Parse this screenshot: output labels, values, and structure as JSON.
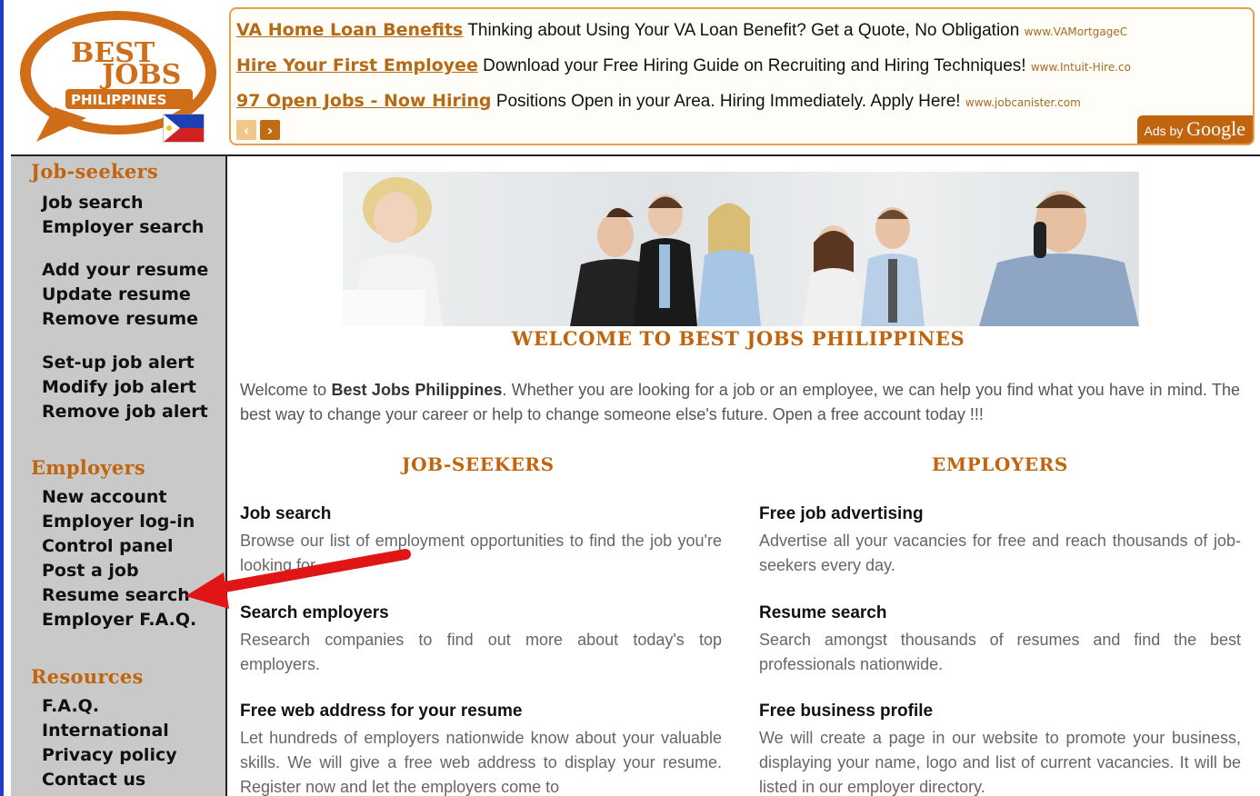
{
  "logo": {
    "line1": "BEST",
    "line2": "JOBS",
    "line3": "PHILIPPINES"
  },
  "ads": {
    "items": [
      {
        "title": "VA Home Loan Benefits",
        "text": "Thinking about Using Your VA Loan Benefit? Get a Quote, No Obligation",
        "url": "www.VAMortgageC"
      },
      {
        "title": "Hire Your First Employee",
        "text": "Download your Free Hiring Guide on Recruiting and Hiring Techniques!",
        "url": "www.Intuit-Hire.co"
      },
      {
        "title": "97 Open Jobs - Now Hiring",
        "text": "Positions Open in your Area. Hiring Immediately. Apply Here!",
        "url": "www.jobcanister.com"
      }
    ],
    "ads_by_prefix": "Ads by",
    "ads_by_brand": "Google"
  },
  "sidebar": {
    "jobseekers_heading": "Job-seekers",
    "jobseekers_items": [
      "Job search",
      "Employer search",
      "Add your resume",
      "Update resume",
      "Remove resume",
      "Set-up job alert",
      "Modify job alert",
      "Remove job alert"
    ],
    "employers_heading": "Employers",
    "employers_items": [
      "New account",
      "Employer log-in",
      "Control panel",
      "Post a job",
      "Resume search",
      "Employer F.A.Q."
    ],
    "resources_heading": "Resources",
    "resources_items": [
      "F.A.Q.",
      "International",
      "Privacy policy",
      "Contact us"
    ]
  },
  "main": {
    "welcome_title": "WELCOME TO BEST JOBS PHILIPPINES",
    "intro_prefix": "Welcome to ",
    "intro_brand": "Best Jobs Philippines",
    "intro_rest": ". Whether you are looking for a job or an employee, we can help you find what you have in mind. The best way to change your career or help to change someone else's future. Open a free account today !!!",
    "jobseekers_heading": "JOB-SEEKERS",
    "employers_heading": "EMPLOYERS",
    "jobseekers_items": [
      {
        "title": "Job search",
        "desc": "Browse our list of employment opportunities to find the job you're looking for."
      },
      {
        "title": "Search employers",
        "desc": "Research companies to find out more about today's top employers."
      },
      {
        "title": "Free web address for your resume",
        "desc": "Let hundreds of employers nationwide know about your valuable skills. We will give a free web address to display your resume. Register now and let the employers come to"
      }
    ],
    "employers_items": [
      {
        "title": "Free job advertising",
        "desc": "Advertise all your vacancies for free and reach thousands of job-seekers every day."
      },
      {
        "title": "Resume search",
        "desc": "Search amongst thousands of resumes and find the best professionals nationwide."
      },
      {
        "title": "Free business profile",
        "desc": "We will create a page in our website to promote your business, displaying your name, logo and list of current vacancies. It will be listed in our employer directory."
      }
    ]
  },
  "colors": {
    "accent": "#c0650e",
    "sidebar_bg": "#c9c9c9",
    "arrow": "#e01515",
    "rail": "#1e3cc8"
  }
}
